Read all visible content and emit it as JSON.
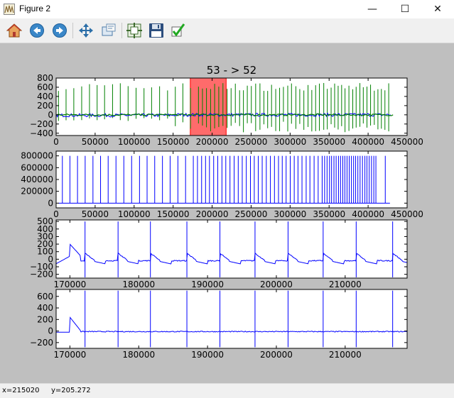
{
  "window": {
    "title": "Figure 2",
    "minimize_glyph": "—",
    "maximize_glyph": "☐",
    "close_glyph": "✕"
  },
  "toolbar": {
    "buttons": [
      {
        "name": "home",
        "icon": "home-icon"
      },
      {
        "name": "back",
        "icon": "back-arrow-icon"
      },
      {
        "name": "forward",
        "icon": "forward-arrow-icon"
      },
      {
        "name": "pan",
        "icon": "move-arrows-icon"
      },
      {
        "name": "zoom",
        "icon": "zoom-rect-icon"
      },
      {
        "name": "subplots",
        "icon": "configure-subplots-icon"
      },
      {
        "name": "save",
        "icon": "floppy-disk-icon"
      },
      {
        "name": "edit",
        "icon": "checkmark-icon"
      }
    ]
  },
  "status": {
    "x_readout": "x=215020",
    "y_readout": "y=205.272"
  },
  "colors": {
    "line_blue": "#0000ff",
    "line_green": "#008000",
    "highlight_red": "#ff6b6b",
    "figure_bg": "#bfbfbf"
  },
  "chart_data": [
    {
      "type": "line",
      "title": "53 - > 52",
      "xlim": [
        0,
        450000
      ],
      "ylim": [
        -450,
        800
      ],
      "x_ticks": [
        0,
        50000,
        100000,
        150000,
        200000,
        250000,
        300000,
        350000,
        400000,
        450000
      ],
      "y_ticks": [
        -400,
        -200,
        0,
        200,
        400,
        600,
        800
      ],
      "x_tick_labels": [
        "0",
        "50000",
        "100000",
        "150000",
        "200000",
        "250000",
        "300000",
        "350000",
        "400000",
        "450000"
      ],
      "y_tick_labels": [
        "−400",
        "−200",
        "0",
        "200",
        "400",
        "600",
        "800"
      ],
      "highlight_span": [
        172000,
        218000
      ],
      "series": [
        {
          "color": "#008000",
          "description": "spiky signal 0-430000, peaks 500-700, troughs to -400"
        },
        {
          "color": "#0000ff",
          "description": "baseline signal near 0"
        }
      ]
    },
    {
      "type": "line",
      "xlim": [
        0,
        450000
      ],
      "ylim": [
        -80000,
        880000
      ],
      "x_ticks": [
        0,
        50000,
        100000,
        150000,
        200000,
        250000,
        300000,
        350000,
        400000,
        450000
      ],
      "y_ticks": [
        0,
        200000,
        400000,
        600000,
        800000
      ],
      "x_tick_labels": [
        "0",
        "50000",
        "100000",
        "150000",
        "200000",
        "250000",
        "300000",
        "350000",
        "400000",
        "450000"
      ],
      "y_tick_labels": [
        "0",
        "200000",
        "400000",
        "600000",
        "800000"
      ],
      "series": [
        {
          "color": "#0000ff",
          "description": "impulse train, pulses to ~800000"
        }
      ]
    },
    {
      "type": "line",
      "xlim": [
        168000,
        219000
      ],
      "ylim": [
        -250,
        520
      ],
      "x_ticks": [
        170000,
        180000,
        190000,
        200000,
        210000
      ],
      "y_ticks": [
        -200,
        -100,
        0,
        100,
        200,
        300,
        400,
        500
      ],
      "x_tick_labels": [
        "170000",
        "180000",
        "190000",
        "200000",
        "210000"
      ],
      "y_tick_labels": [
        "−200",
        "−100",
        "0",
        "100",
        "200",
        "300",
        "400",
        "500"
      ],
      "spikes_x": [
        172200,
        177000,
        181700,
        187000,
        191800,
        196900,
        201700,
        206800,
        211600,
        216900
      ],
      "series": [
        {
          "color": "#0000ff",
          "description": "ECG-like waveform"
        }
      ]
    },
    {
      "type": "line",
      "xlim": [
        168000,
        219000
      ],
      "ylim": [
        -300,
        720
      ],
      "x_ticks": [
        170000,
        180000,
        190000,
        200000,
        210000
      ],
      "y_ticks": [
        -200,
        0,
        200,
        400,
        600
      ],
      "x_tick_labels": [
        "170000",
        "180000",
        "190000",
        "200000",
        "210000"
      ],
      "y_tick_labels": [
        "−200",
        "0",
        "200",
        "400",
        "600"
      ],
      "spikes_x": [
        172200,
        177000,
        181700,
        187000,
        191800,
        196900,
        201700,
        206800,
        211600,
        216900
      ],
      "series": [
        {
          "color": "#0000ff",
          "description": "filtered waveform with tall spikes"
        }
      ]
    }
  ]
}
